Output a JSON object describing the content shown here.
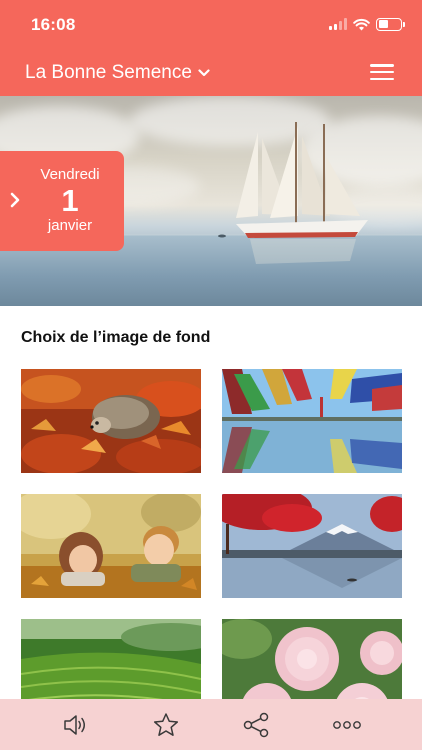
{
  "status_bar": {
    "time": "16:08"
  },
  "header": {
    "title": "La Bonne Semence"
  },
  "date_card": {
    "weekday": "Vendredi",
    "day": "1",
    "month": "janvier"
  },
  "section": {
    "title": "Choix de l’image de fond"
  },
  "backgrounds": [
    {
      "icon": "hedgehog-autumn-image"
    },
    {
      "icon": "colored-yarn-reflection-image"
    },
    {
      "icon": "children-in-leaves-image"
    },
    {
      "icon": "mount-fuji-red-tree-image"
    },
    {
      "icon": "rice-terraces-image"
    },
    {
      "icon": "pink-peonies-image"
    }
  ],
  "tabbar": {
    "items": [
      "speaker-icon",
      "star-icon",
      "share-icon",
      "more-icon"
    ]
  },
  "colors": {
    "accent": "#f5675b",
    "tabbar": "#f6d2d2"
  }
}
